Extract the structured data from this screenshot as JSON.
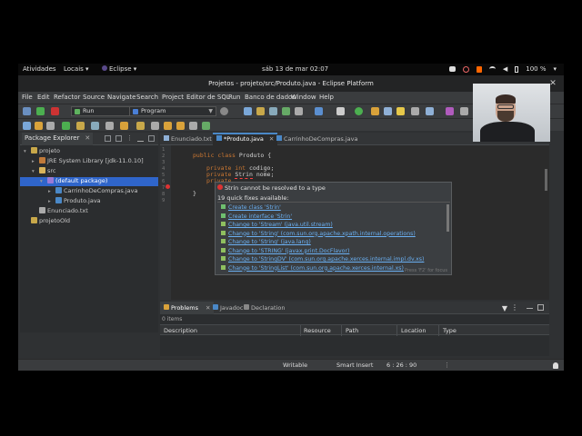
{
  "topbar": {
    "activities": "Atividades",
    "locais": "Locais",
    "app": "Eclipse",
    "clock": "sáb 13 de mar  02:07",
    "battery": "100 %"
  },
  "window": {
    "title": "Projetos - projeto/src/Produto.java - Eclipse Platform"
  },
  "menu": [
    "File",
    "Edit",
    "Refactor",
    "Source",
    "Navigate",
    "Search",
    "Project",
    "Editor de SQL",
    "Run",
    "Banco de dados",
    "Window",
    "Help"
  ],
  "toolbar": {
    "run_combo": "Run",
    "program_combo": "Program"
  },
  "explorer": {
    "tab_label": "Package Explorer",
    "tree": [
      {
        "label": "projeto",
        "indent": 0,
        "icon": "project-icon",
        "selected": false
      },
      {
        "label": "JRE System Library [jdk-11.0.10]",
        "indent": 1,
        "icon": "library-icon",
        "selected": false
      },
      {
        "label": "src",
        "indent": 1,
        "icon": "folder-icon",
        "selected": false
      },
      {
        "label": "(default package)",
        "indent": 2,
        "icon": "package-icon",
        "selected": true
      },
      {
        "label": "CarrinhoDeCompras.java",
        "indent": 3,
        "icon": "java-file-icon",
        "selected": false
      },
      {
        "label": "Produto.java",
        "indent": 3,
        "icon": "java-file-icon",
        "selected": false
      },
      {
        "label": "Enunciado.txt",
        "indent": 1,
        "icon": "text-file-icon",
        "selected": false
      },
      {
        "label": "projetoOld",
        "indent": 0,
        "icon": "project-icon",
        "selected": false
      }
    ]
  },
  "editor": {
    "tabs": [
      {
        "label": "Enunciado.txt",
        "active": false
      },
      {
        "label": "*Produto.java",
        "active": true
      },
      {
        "label": "CarrinhoDeCompras.java",
        "active": false
      }
    ],
    "line_numbers": [
      "1",
      "2",
      "3",
      "4",
      "5",
      "6",
      "7",
      "8",
      "9"
    ],
    "code": {
      "l2_kw": "public class",
      "l2_rest": " Produto {",
      "l4_kw": "private int",
      "l4_rest": " codigo;",
      "l5_kw": "private",
      "l5_type": "Strin",
      "l5_rest": " nome;",
      "l6_kw": "private",
      "l8": "}"
    }
  },
  "quickfix": {
    "title": "Strin cannot be resolved to a type",
    "count": "19 quick fixes available:",
    "fixes": [
      "Create class 'Strin'",
      "Create interface 'Strin'",
      "Change to 'Stream' (java.util.stream)",
      "Change to 'String' (com.sun.org.apache.xpath.internal.operations)",
      "Change to 'String' (java.lang)",
      "Change to 'STRING' (javax.print.DocFlavor)",
      "Change to 'StringDV' (com.sun.org.apache.xerces.internal.impl.dv.xs)",
      "Change to 'StringList' (com.sun.org.apache.xerces.internal.xs)"
    ],
    "footer": "Press 'F2' for focus"
  },
  "bottom": {
    "tabs": [
      "Problems",
      "Javadoc",
      "Declaration"
    ],
    "items": "0 items",
    "columns": [
      "Description",
      "Resource",
      "Path",
      "Location",
      "Type"
    ]
  },
  "status": {
    "mode": "Writable",
    "insert": "Smart Insert",
    "position": "6 : 26 : 90"
  }
}
